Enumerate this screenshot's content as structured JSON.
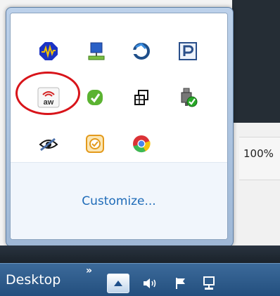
{
  "popup": {
    "customize_label": "Customize..."
  },
  "tray_icons": [
    "audio-waveform-icon",
    "network-computer-icon",
    "refresh-e-icon",
    "p-letter-icon",
    "aw-icon",
    "green-leaf-icon",
    "windows-tiles-icon",
    "usb-checkmark-icon",
    "eye-pen-icon",
    "orange-check-icon",
    "chrome-icon"
  ],
  "annotation": {
    "color": "#d8141a"
  },
  "zoom": {
    "text": "100%"
  },
  "taskbar": {
    "desktop_label": "Desktop",
    "chevron": "»",
    "show_hidden_icon": "triangle-up-icon",
    "tray_icons": [
      "speaker-icon",
      "action-flag-icon",
      "network-icon"
    ]
  },
  "aw_badge": {
    "text": "aw"
  }
}
